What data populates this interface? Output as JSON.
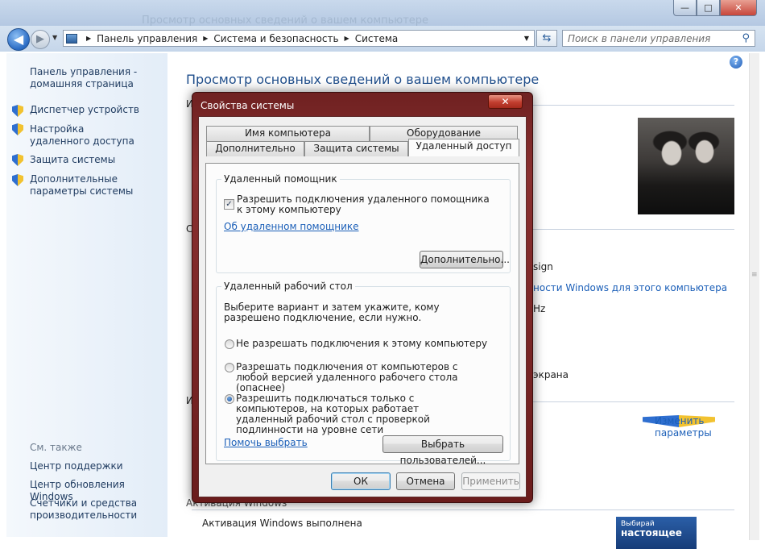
{
  "window": {
    "ghost_title": "Просмотр основных сведений о вашем компьютере",
    "min_glyph": "—",
    "max_glyph": "□",
    "close_glyph": "✕"
  },
  "nav": {
    "back_glyph": "◀",
    "forward_glyph": "▶",
    "history_glyph": "▼",
    "breadcrumb": [
      "Панель управления",
      "Система и безопасность",
      "Система"
    ],
    "sep_glyph": "▶",
    "refresh_glyph": "⇆",
    "search_placeholder": "Поиск в панели управления",
    "search_glyph": "⚲"
  },
  "sidebar": {
    "home": "Панель управления - домашняя страница",
    "items": [
      {
        "label": "Диспетчер устройств"
      },
      {
        "label": "Настройка удаленного доступа"
      },
      {
        "label": "Защита системы"
      },
      {
        "label": "Дополнительные параметры системы"
      }
    ],
    "see_also_title": "См. также",
    "see_also": [
      "Центр поддержки",
      "Центр обновления Windows",
      "Счетчики и средства производительности"
    ]
  },
  "main": {
    "title": "Просмотр основных сведений о вашем компьютере",
    "help_glyph": "?",
    "frag_1": "И",
    "frag_2": "С",
    "frag_3": "И",
    "frag_sign": "sign",
    "frag_link": "ности Windows для этого компьютера",
    "frag_hz": "Hz",
    "frag_screen": "экрана",
    "change_params": "Изменить параметры",
    "activation_header": "Активация Windows",
    "activation_status": "Активация Windows выполнена",
    "ad_line1": "Выбирай",
    "ad_line2": "настоящее"
  },
  "dialog": {
    "title": "Свойства системы",
    "close_glyph": "✕",
    "tabs_row1": [
      "Имя компьютера",
      "Оборудование"
    ],
    "tabs_row2": [
      "Дополнительно",
      "Защита системы",
      "Удаленный доступ"
    ],
    "active_tab": "Удаленный доступ",
    "assist": {
      "title": "Удаленный помощник",
      "checkbox_label": "Разрешить подключения удаленного помощника к этому компьютеру",
      "checked": true,
      "check_glyph": "✓",
      "link": "Об удаленном помощнике",
      "advanced_button": "Дополнительно..."
    },
    "rdp": {
      "title": "Удаленный рабочий стол",
      "instruction": "Выберите вариант и затем укажите, кому разрешено подключение, если нужно.",
      "options": [
        {
          "label": "Не разрешать подключения к этому компьютеру",
          "selected": false
        },
        {
          "label": "Разрешать подключения от компьютеров с любой версией удаленного рабочего стола (опаснее)",
          "selected": false
        },
        {
          "label": "Разрешить подключаться только с компьютеров, на которых работает удаленный рабочий стол с проверкой подлинности на уровне сети",
          "selected": true
        }
      ],
      "help_link": "Помочь выбрать",
      "select_users_button": "Выбрать пользователей..."
    },
    "buttons": {
      "ok": "ОК",
      "cancel": "Отмена",
      "apply": "Применить"
    }
  }
}
